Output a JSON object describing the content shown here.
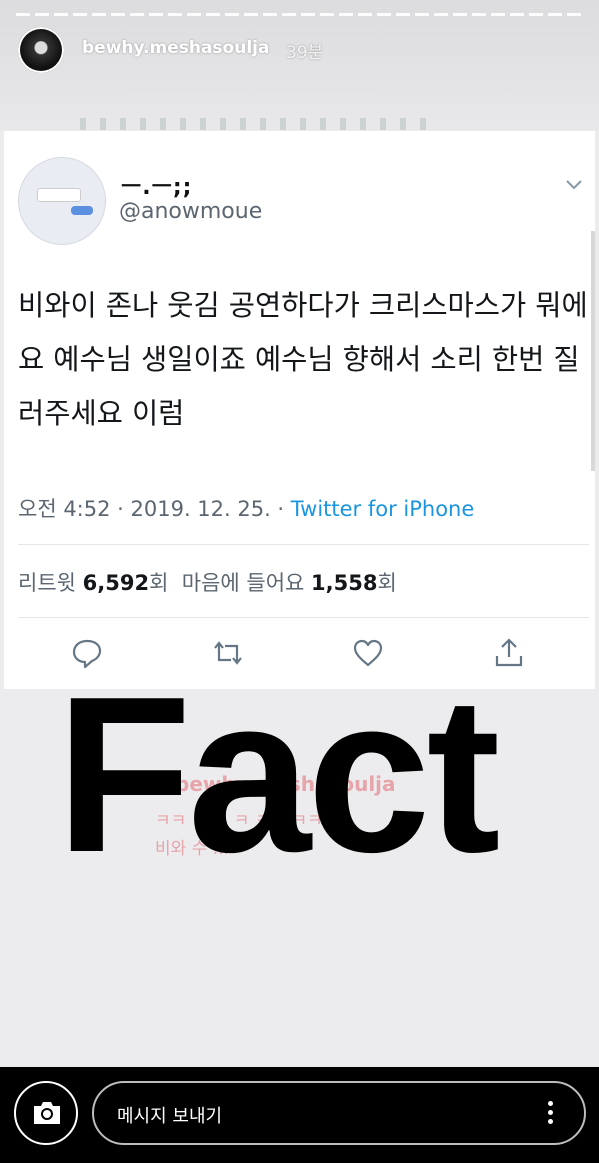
{
  "story": {
    "username": "bewhy.meshasoulja",
    "time_ago": "39분"
  },
  "tweet": {
    "display_name": "ㅡ.ㅡ;;",
    "handle": "@anowmoue",
    "text": "비와이 존나 웃김 공연하다가 크리스마스가 뭐에요 예수님 생일이죠 예수님 향해서 소리 한번 질러주세요 이럼",
    "time": "오전 4:52 · 2019. 12. 25. · ",
    "source": "Twitter for iPhone",
    "retweets_label": "리트윗 ",
    "retweets_count": "6,592",
    "count_suffix": "회",
    "likes_label": "마음에 들어요 ",
    "likes_count": "1,558"
  },
  "overlay": {
    "sticker_text": "Fact",
    "faint_mention": "@bewhy.meshasoulja",
    "faint_line1": "ㅋㅋ ㅋ  ㅋ  ㅋ  ㅋ  ㅋㅋㅋㅋ",
    "faint_line2": "비와        수 ..."
  },
  "reply_bar": {
    "placeholder": "메시지 보내기"
  },
  "icons": [
    "camera-icon",
    "more-dots-icon",
    "reply-icon",
    "retweet-icon",
    "like-icon",
    "share-icon",
    "chevron-down-icon"
  ]
}
